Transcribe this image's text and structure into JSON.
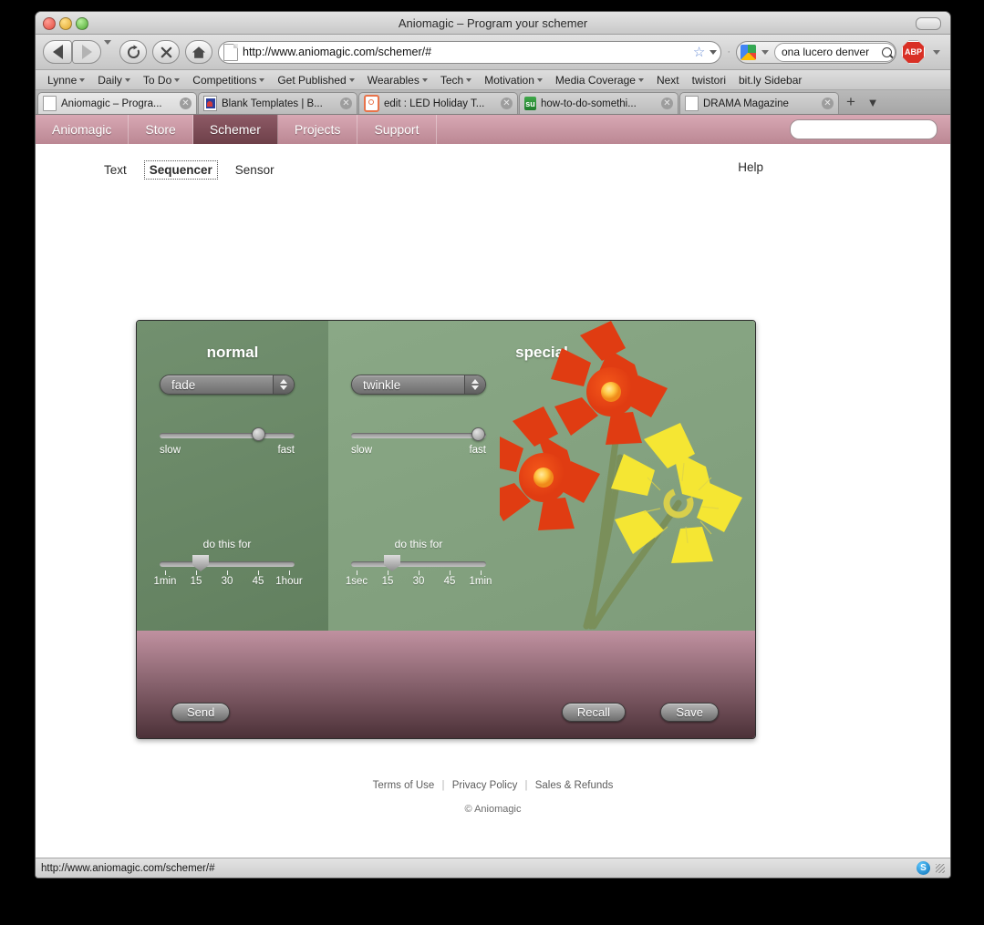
{
  "window": {
    "title": "Aniomagic – Program your schemer"
  },
  "toolbar": {
    "back_label": "Back",
    "forward_label": "Forward",
    "reload_label": "Reload",
    "stop_label": "Stop",
    "home_label": "Home",
    "url": "http://www.aniomagic.com/schemer/#",
    "search_value": "ona lucero denver",
    "search_engine": "Google",
    "adblock_label": "ABP"
  },
  "bookmarks": [
    {
      "label": "Lynne",
      "has_menu": true
    },
    {
      "label": "Daily",
      "has_menu": true
    },
    {
      "label": "To Do",
      "has_menu": true
    },
    {
      "label": "Competitions",
      "has_menu": true
    },
    {
      "label": "Get Published",
      "has_menu": true
    },
    {
      "label": "Wearables",
      "has_menu": true
    },
    {
      "label": "Tech",
      "has_menu": true
    },
    {
      "label": "Motivation",
      "has_menu": true
    },
    {
      "label": "Media Coverage",
      "has_menu": true
    },
    {
      "label": "Next",
      "has_menu": false
    },
    {
      "label": "twistori",
      "has_menu": false
    },
    {
      "label": "bit.ly Sidebar",
      "has_menu": false
    }
  ],
  "tabs": [
    {
      "label": "Aniomagic – Progra...",
      "favicon": "document-icon",
      "active": true
    },
    {
      "label": "Blank Templates | B...",
      "favicon": "blue-book-icon",
      "active": false
    },
    {
      "label": "edit : LED Holiday T...",
      "favicon": "orange-ring-icon",
      "active": false
    },
    {
      "label": "how-to-do-somethi...",
      "favicon": "stumbleupon-icon",
      "active": false
    },
    {
      "label": "DRAMA Magazine",
      "favicon": "document-icon",
      "active": false
    }
  ],
  "tabstrip": {
    "new_tab_label": "+",
    "list_all_tabs_label": "▼"
  },
  "sitenav": {
    "items": [
      {
        "label": "Aniomagic",
        "active": false
      },
      {
        "label": "Store",
        "active": false
      },
      {
        "label": "Schemer",
        "active": true
      },
      {
        "label": "Projects",
        "active": false
      },
      {
        "label": "Support",
        "active": false
      }
    ],
    "search_placeholder": ""
  },
  "subnav": {
    "items": [
      {
        "label": "Text",
        "selected": false
      },
      {
        "label": "Sequencer",
        "selected": true
      },
      {
        "label": "Sensor",
        "selected": false
      }
    ],
    "help_label": "Help"
  },
  "app": {
    "normal": {
      "title": "normal",
      "effect_value": "fade",
      "speed": {
        "min_label": "slow",
        "max_label": "fast",
        "percent": 76
      },
      "duration": {
        "label": "do this for",
        "percent": 28,
        "ticks": [
          "1min",
          "15",
          "30",
          "45",
          "1hour"
        ]
      }
    },
    "special": {
      "title": "special",
      "effect_value": "twinkle",
      "speed": {
        "min_label": "slow",
        "max_label": "fast",
        "percent": 99
      },
      "duration": {
        "label": "do this for",
        "percent": 28,
        "ticks": [
          "1sec",
          "15",
          "30",
          "45",
          "1min"
        ]
      }
    },
    "buttons": {
      "send": "Send",
      "recall": "Recall",
      "save": "Save"
    },
    "illustration": {
      "name": "flowers-illustration",
      "flowers": [
        {
          "color": "#e03c12",
          "center": "#ffc845"
        },
        {
          "color": "#e03c12",
          "center": "#ffc845"
        },
        {
          "color": "#f5e633",
          "center": "#d8cf4c"
        }
      ],
      "stem_color": "#7a8f5a"
    }
  },
  "page_footer": {
    "links": [
      "Terms of Use",
      "Privacy Policy",
      "Sales & Refunds"
    ],
    "copyright": "© Aniomagic"
  },
  "statusbar": {
    "url": "http://www.aniomagic.com/schemer/#",
    "skype_label": "S"
  }
}
